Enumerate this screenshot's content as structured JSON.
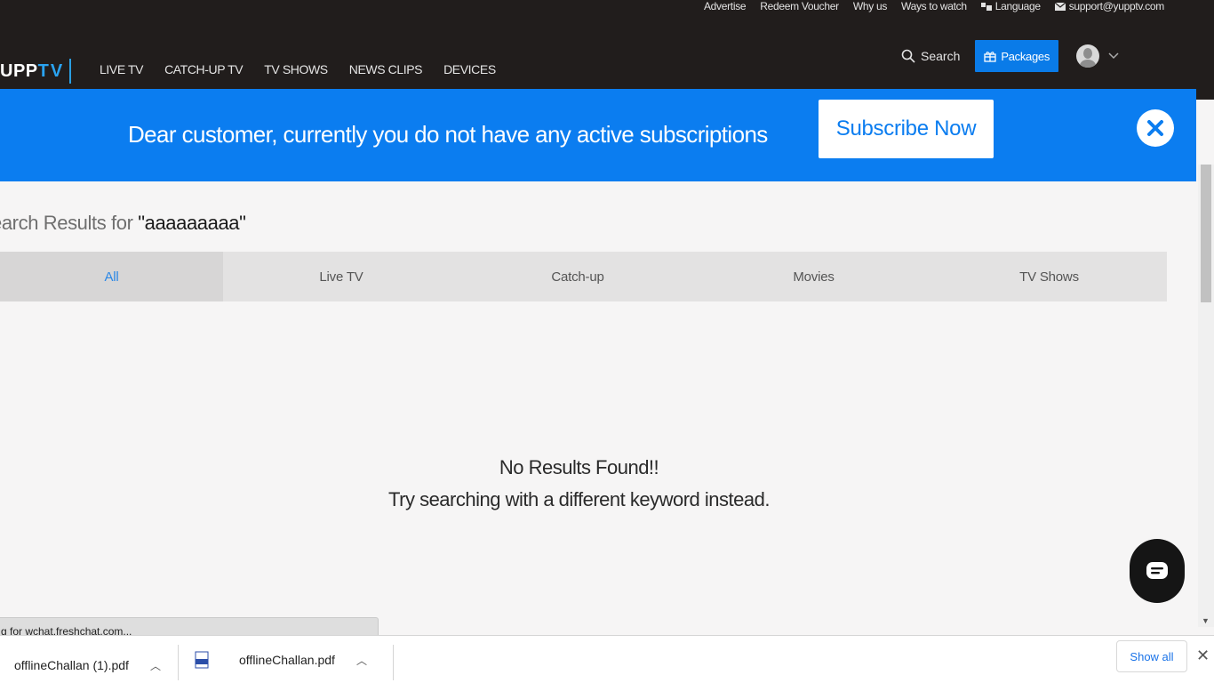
{
  "top_links": {
    "advertise": "Advertise",
    "redeem_voucher": "Redeem Voucher",
    "why_us": "Why us",
    "ways_to_watch": "Ways to watch",
    "language": "Language",
    "support_email": "support@yupptv.com"
  },
  "nav": {
    "logo_part1": "UPP",
    "logo_part2": "TV",
    "menu": [
      "LIVE TV",
      "CATCH-UP TV",
      "TV SHOWS",
      "NEWS CLIPS",
      "DEVICES"
    ],
    "search_label": "Search",
    "packages_label": "Packages"
  },
  "banner": {
    "message": "Dear customer, currently you do not have any active subscriptions",
    "cta": "Subscribe Now"
  },
  "results": {
    "prefix": "earch Results for ",
    "query": "\"aaaaaaaaa\"",
    "tabs": [
      "All",
      "Live TV",
      "Catch-up",
      "Movies",
      "TV Shows"
    ],
    "active_tab": "All",
    "empty_line1": "No Results Found!!",
    "empty_line2": "Try searching with a different keyword instead."
  },
  "browser": {
    "status_text": "g for wchat.freshchat.com...",
    "downloads": [
      "offlineChallan (1).pdf",
      "offlineChallan.pdf"
    ],
    "show_all": "Show all"
  },
  "colors": {
    "brand_blue": "#0b7df0",
    "header_bg": "#211d1c",
    "active_tab_text": "#2c88e6"
  }
}
